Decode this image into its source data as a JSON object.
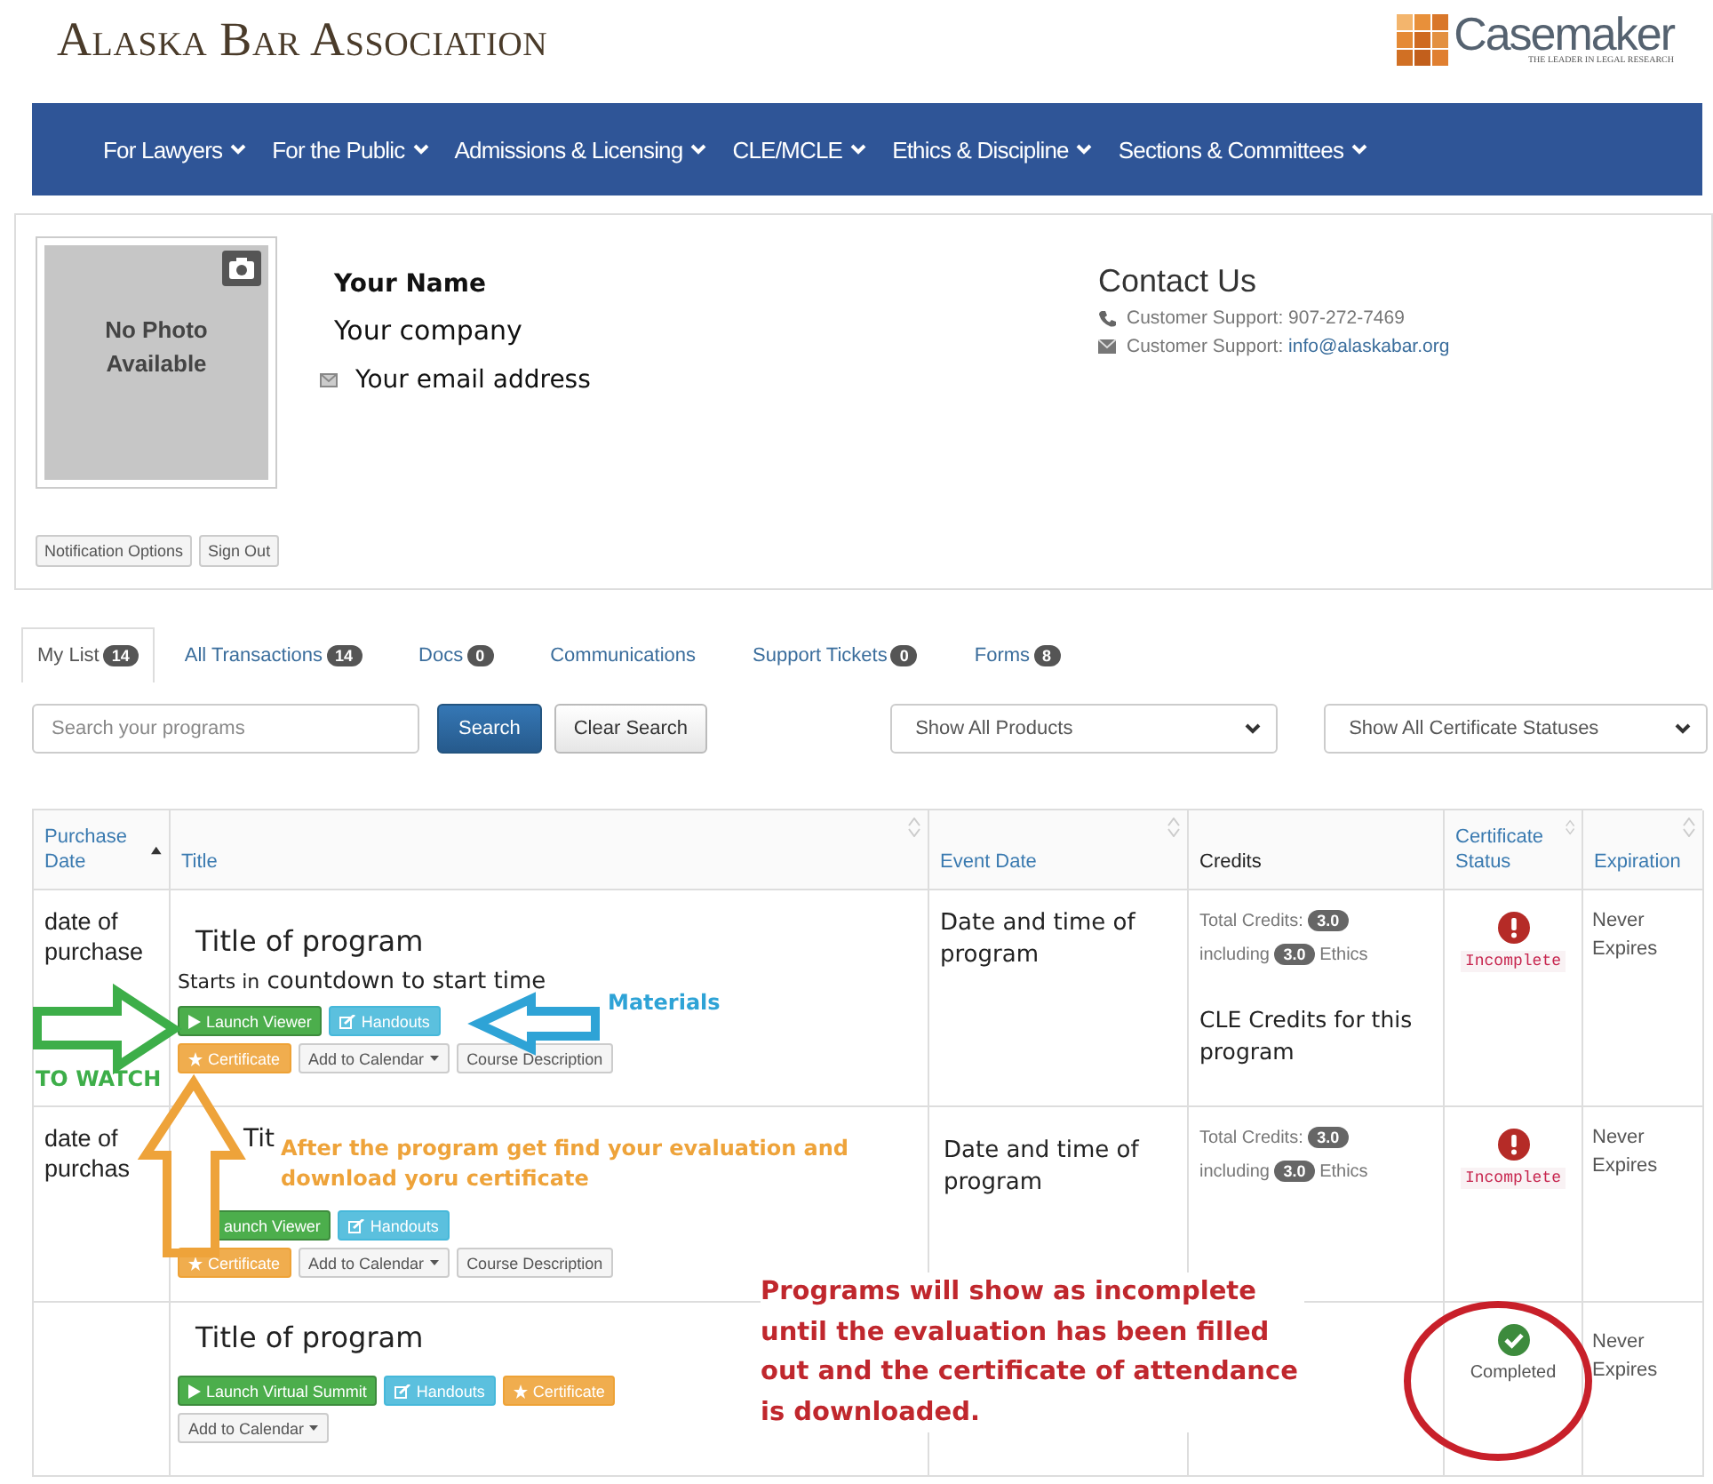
{
  "header": {
    "logo": "Alaska Bar Association",
    "partner": {
      "name": "Casemaker",
      "tagline": "THE LEADER IN LEGAL RESEARCH"
    }
  },
  "nav": [
    {
      "label": "For Lawyers"
    },
    {
      "label": "For the Public"
    },
    {
      "label": "Admissions & Licensing"
    },
    {
      "label": "CLE/MCLE"
    },
    {
      "label": "Ethics & Discipline"
    },
    {
      "label": "Sections & Committees"
    }
  ],
  "profile": {
    "photo_text": "No Photo Available",
    "name": "Your Name",
    "company": "Your company",
    "email": "Your email address",
    "buttons": [
      "Notification Options",
      "Sign Out"
    ]
  },
  "contact": {
    "title": "Contact Us",
    "lines": [
      {
        "kind": "phone",
        "text": "Customer Support: 907-272-7469"
      },
      {
        "kind": "email",
        "text": "Customer Support:",
        "link": "info@alaskabar.org"
      }
    ]
  },
  "tabs": [
    {
      "label": "My List",
      "count": "14",
      "selected": true
    },
    {
      "label": "All Transactions",
      "count": "14",
      "selected": false
    },
    {
      "label": "Docs",
      "count": "0",
      "selected": false
    },
    {
      "label": "Communications",
      "selected": false
    },
    {
      "label": "Support Tickets",
      "count": "0",
      "selected": false
    },
    {
      "label": "Forms",
      "count": "8",
      "selected": false
    }
  ],
  "search": {
    "placeholder": "Search your programs",
    "button": "Search",
    "clear": "Clear Search"
  },
  "filters": [
    {
      "label": "Show All Products"
    },
    {
      "label": "Show All Certificate Statuses"
    }
  ],
  "table": {
    "columns": [
      {
        "label": "Purchase Date",
        "sortable": true,
        "sorted": true
      },
      {
        "label": "Title",
        "sortable": true,
        "sorted": false
      },
      {
        "label": "Event Date",
        "sortable": true,
        "sorted": false
      },
      {
        "label": "Credits",
        "sortable": false,
        "sorted": false
      },
      {
        "label": "Certificate Status",
        "sortable": true,
        "sorted": false
      },
      {
        "label": "Expiration",
        "sortable": true,
        "sorted": false
      }
    ],
    "rows": [
      {
        "purchase_date": "date of purchase",
        "title": "Title of program",
        "countdown": {
          "prefix": "Starts in",
          "text": "countdown to start time"
        },
        "button_rows": [
          [
            {
              "kind": "launch",
              "label": "Launch Viewer",
              "show_icon": true
            },
            {
              "kind": "handouts",
              "label": "Handouts",
              "show_icon": true
            }
          ],
          [
            {
              "kind": "certificate",
              "label": "Certificate",
              "show_icon": true
            },
            {
              "kind": "calendar",
              "label": "Add to Calendar",
              "show_icon": true
            },
            {
              "kind": "description",
              "label": "Course Description"
            }
          ]
        ],
        "event_date": "Date and time of program",
        "credits": {
          "total_label": "Total Credits:",
          "total": "3.0",
          "including_label": "including",
          "ethics": "3.0",
          "ethics_label": "Ethics",
          "note": "CLE Credits for this program"
        },
        "status": {
          "kind": "incomplete",
          "label": "Incomplete"
        },
        "expiration": "Never Expires"
      },
      {
        "purchase_date": "date of purchas",
        "title": "Tit",
        "button_rows": [
          [
            {
              "kind": "launch",
              "label": "aunch Viewer",
              "show_icon": false
            },
            {
              "kind": "handouts",
              "label": "Handouts",
              "show_icon": true
            }
          ],
          [
            {
              "kind": "certificate",
              "label": "Certificate",
              "show_icon": true
            },
            {
              "kind": "calendar",
              "label": "Add to Calendar",
              "show_icon": true
            },
            {
              "kind": "description",
              "label": "Course Description"
            }
          ]
        ],
        "event_date": "Date and time of program",
        "credits": {
          "total_label": "Total Credits:",
          "total": "3.0",
          "including_label": "including",
          "ethics": "3.0",
          "ethics_label": "Ethics"
        },
        "status": {
          "kind": "incomplete",
          "label": "Incomplete"
        },
        "expiration": "Never Expires"
      },
      {
        "title": "Title of program",
        "button_rows": [
          [
            {
              "kind": "launch",
              "label": "Launch Virtual Summit",
              "show_icon": true
            },
            {
              "kind": "handouts",
              "label": "Handouts",
              "show_icon": true
            },
            {
              "kind": "certificate",
              "label": "Certificate",
              "show_icon": true
            }
          ],
          [
            {
              "kind": "calendar",
              "label": "Add to Calendar",
              "show_icon": true
            }
          ]
        ],
        "status": {
          "kind": "completed",
          "label": "Completed"
        },
        "expiration": "Never Expires"
      }
    ]
  },
  "annotations": [
    {
      "kind": "arrow_right",
      "color": "#3dae49",
      "label": "TO WATCH"
    },
    {
      "kind": "arrow_left",
      "color": "#2ea3d6",
      "label": "Materials"
    },
    {
      "kind": "arrow_up",
      "color": "#eea33a",
      "label": "After the program get find your evaluation and\ndownload yoru certificate"
    },
    {
      "kind": "note",
      "color": "#c0272d",
      "label": "Programs will show as incomplete\nuntil the evaluation has been filled\nout and the certificate of attendance\nis downloaded."
    },
    {
      "kind": "ellipse",
      "color": "#c8202a"
    }
  ]
}
